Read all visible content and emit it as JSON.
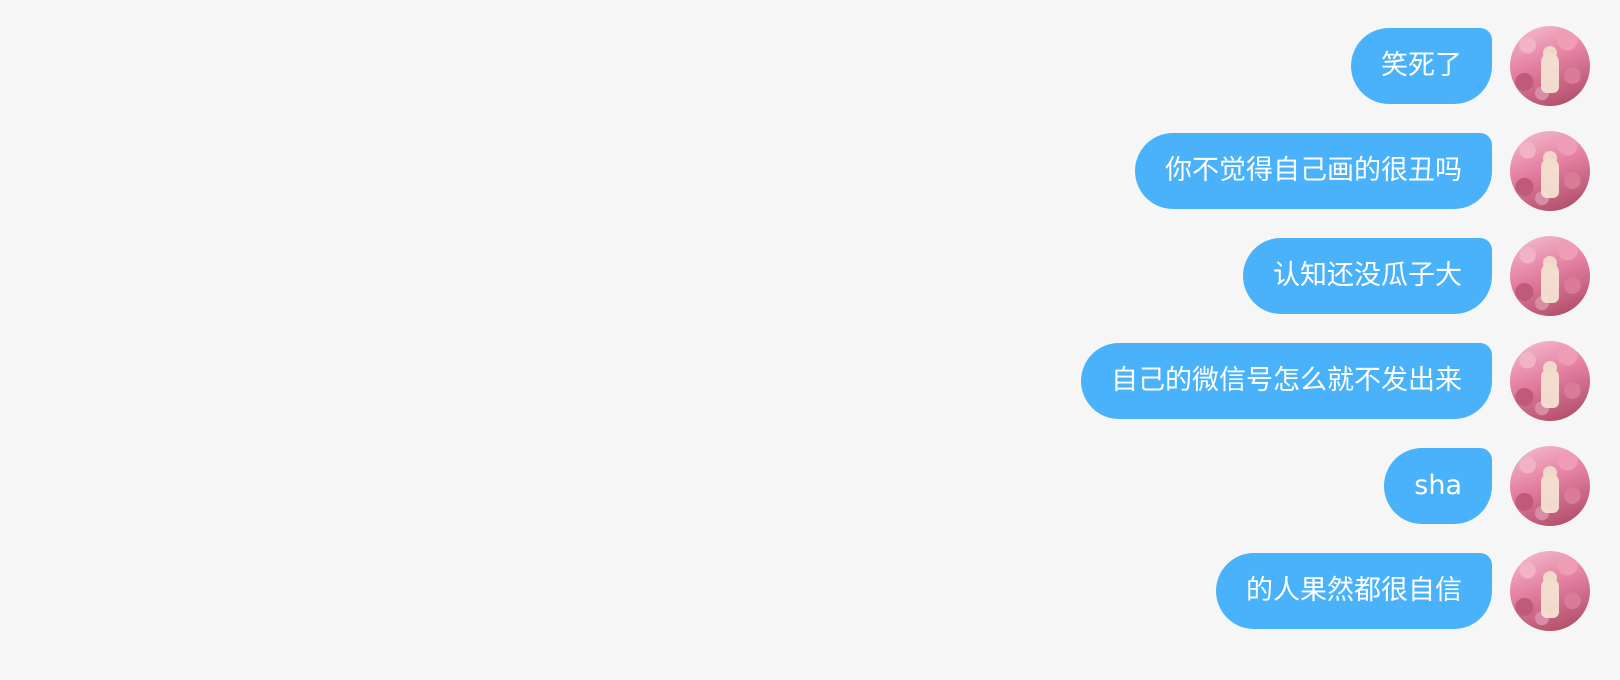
{
  "messages": [
    {
      "text": "笑死了"
    },
    {
      "text": "你不觉得自己画的很丑吗"
    },
    {
      "text": "认知还没瓜子大"
    },
    {
      "text": "自己的微信号怎么就不发出来"
    },
    {
      "text": "sha"
    },
    {
      "text": "的人果然都很自信"
    }
  ]
}
